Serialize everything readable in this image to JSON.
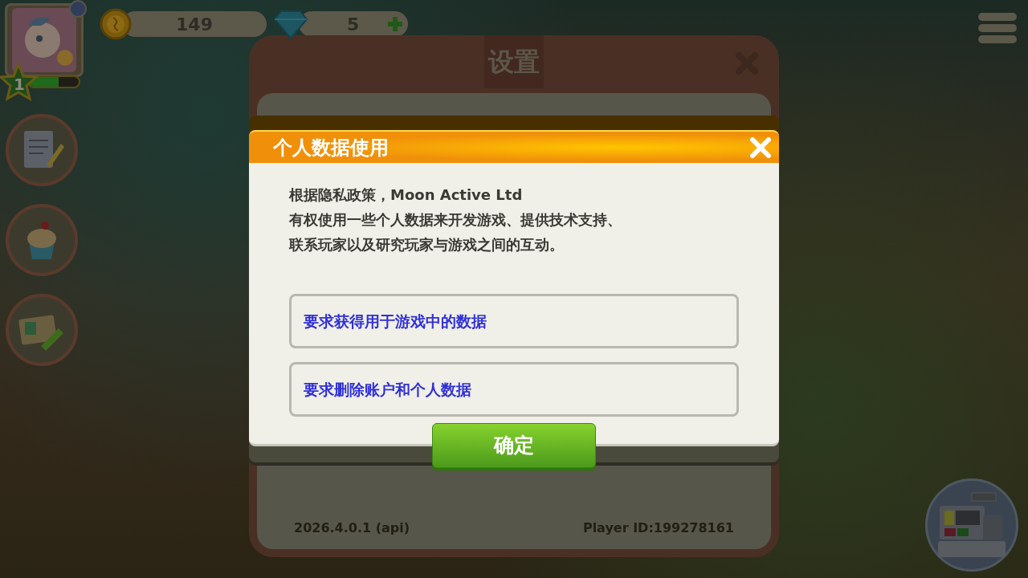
{
  "hud": {
    "player_level": "1",
    "xp": {
      "level": 0.6
    },
    "coins": "149",
    "gems": "5"
  },
  "settings": {
    "title": "设置",
    "version": "2026.4.0.1 (api)",
    "player_id": "Player ID:199278161"
  },
  "dialog": {
    "title": "个人数据使用",
    "body": [
      "根据隐私政策，Moon Active Ltd",
      "有权使用一些个人数据来开发游戏、提供技术支持、",
      "联系玩家以及研究玩家与游戏之间的互动。"
    ],
    "options": [
      "要求获得用于游戏中的数据",
      "要求删除账户和个人数据"
    ],
    "confirm": "确定"
  }
}
